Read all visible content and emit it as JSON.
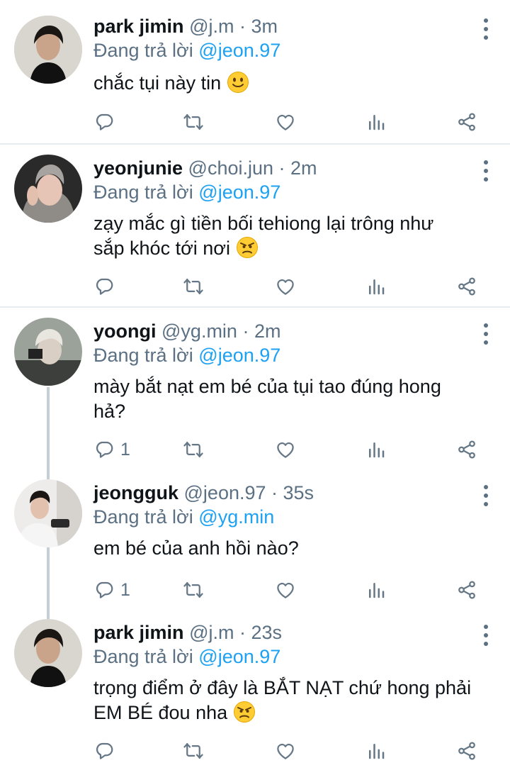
{
  "reply_prefix": "Đang trả lời",
  "tweets": [
    {
      "name": "park jimin",
      "meta": "@j.m · 3m",
      "reply_to": "@jeon.97",
      "text": "chắc tụi này tin",
      "emoji": "slightly-smiling-face",
      "reply_count": ""
    },
    {
      "name": "yeonjunie",
      "meta": "@choi.jun · 2m",
      "reply_to": "@jeon.97",
      "text": "zạy mắc gì tiền bối tehiong lại trông như sắp khóc tới nơi",
      "emoji": "angry-face",
      "reply_count": ""
    },
    {
      "name": "yoongi",
      "meta": "@yg.min · 2m",
      "reply_to": "@jeon.97",
      "text": "mày bắt nạt em bé của tụi tao đúng hong hả?",
      "reply_count": "1"
    },
    {
      "name": "jeongguk",
      "meta": "@jeon.97 · 35s",
      "reply_to": "@yg.min",
      "text": "em bé của anh hồi nào?",
      "reply_count": "1"
    },
    {
      "name": "park jimin",
      "meta": "@j.m · 23s",
      "reply_to": "@jeon.97",
      "text": "trọng điểm ở đây là BẮT NẠT chứ hong phải EM BÉ đou nha",
      "emoji": "angry-face",
      "reply_count": ""
    }
  ],
  "icons": {
    "reply": "reply-icon",
    "retweet": "retweet-icon",
    "like": "like-icon",
    "analytics": "analytics-icon",
    "share": "share-icon",
    "more": "more-options-icon"
  },
  "colors": {
    "mention": "#1da1f2",
    "secondary_text": "#5b7083",
    "icon": "#657786",
    "divider": "#e6ecf0",
    "thread_line": "#c4cfd6"
  }
}
